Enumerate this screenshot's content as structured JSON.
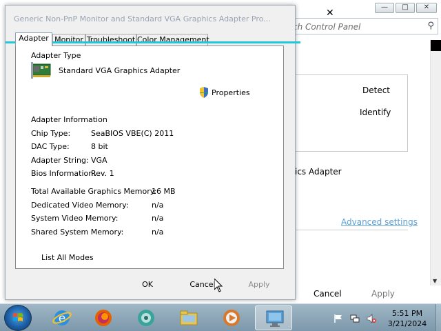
{
  "background_window": {
    "search_placeholder": "ch Control Panel",
    "detect_label": "Detect",
    "identify_label": "Identify",
    "adapter_text": "ics Adapter",
    "advanced_settings_label": "Advanced settings",
    "cancel_label": "Cancel",
    "apply_label": "Apply"
  },
  "dialog": {
    "title": "Generic Non-PnP Monitor and Standard VGA Graphics Adapter Pro...",
    "tabs": [
      "Adapter",
      "Monitor",
      "Troubleshoot",
      "Color Management"
    ],
    "active_tab": "Adapter",
    "adapter_type_heading": "Adapter Type",
    "adapter_name": "Standard VGA Graphics Adapter",
    "properties_label": "Properties",
    "adapter_info_heading": "Adapter Information",
    "info_rows": [
      {
        "label": "Chip Type:",
        "value": "SeaBIOS VBE(C) 2011"
      },
      {
        "label": "DAC Type:",
        "value": "8 bit"
      },
      {
        "label": "Adapter String:",
        "value": "VGA"
      },
      {
        "label": "Bios Information:",
        "value": "Rev. 1"
      }
    ],
    "memory_rows": [
      {
        "label": "Total Available Graphics Memory:",
        "value": "16 MB"
      },
      {
        "label": "Dedicated Video Memory:",
        "value": "n/a"
      },
      {
        "label": "System Video Memory:",
        "value": "n/a"
      },
      {
        "label": "Shared System Memory:",
        "value": "n/a"
      }
    ],
    "list_all_modes_label": "List All Modes",
    "ok_label": "OK",
    "cancel_label": "Cancel",
    "apply_label": "Apply"
  },
  "taskbar": {
    "apps": [
      "internet-explorer",
      "firefox",
      "app-green",
      "file-explorer",
      "media-player",
      "display-settings"
    ],
    "active_app": "display-settings",
    "clock_time": "5:51 PM",
    "clock_date": "3/21/2024"
  },
  "colors": {
    "accent_cyan": "#22c6d8",
    "link_blue": "#5a9fd4",
    "taskbar_top": "#9fb7c6"
  }
}
